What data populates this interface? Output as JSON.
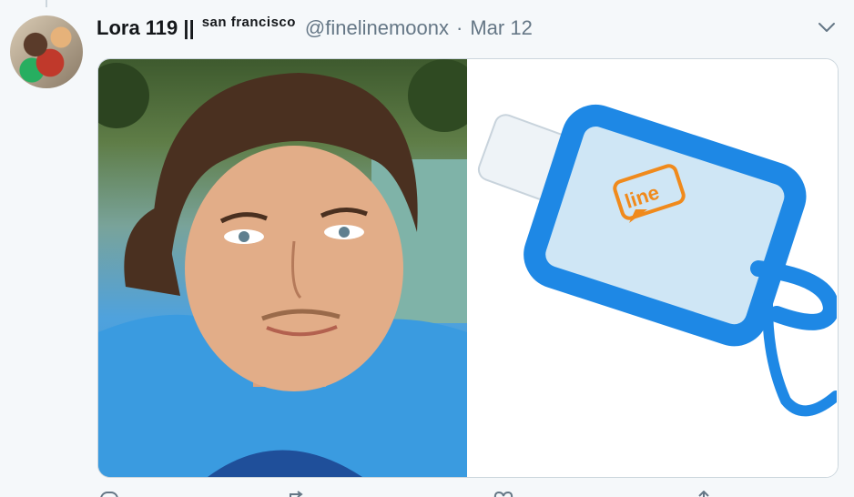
{
  "tweet": {
    "display_name": "Lora 119 ||",
    "location_tag": "san francisco",
    "handle": "@finelinemoonx",
    "separator": "·",
    "date": "Mar 12"
  },
  "media": {
    "left_image": "portrait-photo",
    "right_image": "hand-sanitizer-photo",
    "logo_text": "line"
  },
  "icons": [
    "chevron-down-icon",
    "reply-icon",
    "retweet-icon",
    "like-icon",
    "share-icon"
  ],
  "colors": {
    "name_text": "#14171a",
    "secondary_text": "#657786",
    "border": "#ccd6dd",
    "background": "#f5f8fa",
    "sanitizer_blue": "#1e88e5",
    "logo_orange": "#f08a1c"
  }
}
